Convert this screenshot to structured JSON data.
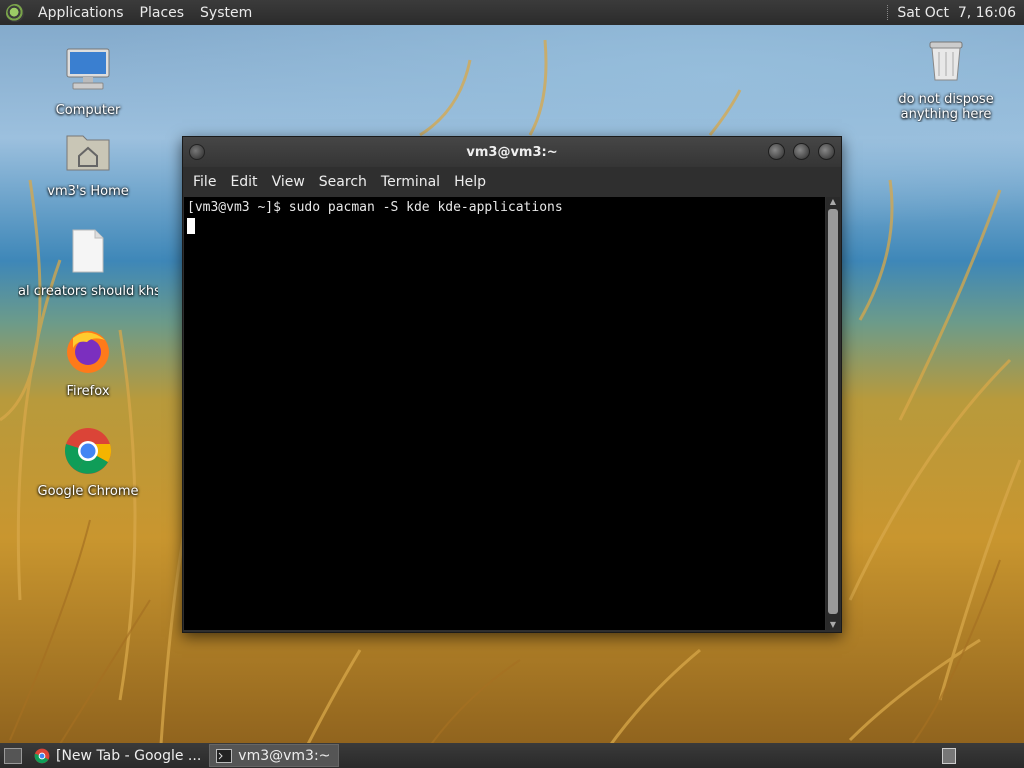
{
  "top_panel": {
    "menus": [
      "Applications",
      "Places",
      "System"
    ],
    "clock": "Sat Oct  7, 16:06"
  },
  "desktop_icons": [
    {
      "label": "Computer",
      "icon": "computer-icon"
    },
    {
      "label": "vm3's Home",
      "icon": "home-folder-icon"
    },
    {
      "label": "al creators should khs",
      "icon": "document-icon"
    },
    {
      "label": "Firefox",
      "icon": "firefox-icon"
    },
    {
      "label": "Google Chrome",
      "icon": "chrome-icon"
    },
    {
      "label": "do not dispose anything here",
      "label_line1": "do not dispose",
      "label_line2": "anything here",
      "icon": "trash-icon"
    }
  ],
  "terminal": {
    "title": "vm3@vm3:~",
    "menu": [
      "File",
      "Edit",
      "View",
      "Search",
      "Terminal",
      "Help"
    ],
    "prompt_line": "[vm3@vm3 ~]$ sudo pacman -S kde kde-applications"
  },
  "taskbar": {
    "tasks": [
      {
        "label": "[New Tab - Google ...",
        "icon": "chrome-icon",
        "active": false
      },
      {
        "label": "vm3@vm3:~",
        "icon": "terminal-icon",
        "active": true
      }
    ]
  }
}
